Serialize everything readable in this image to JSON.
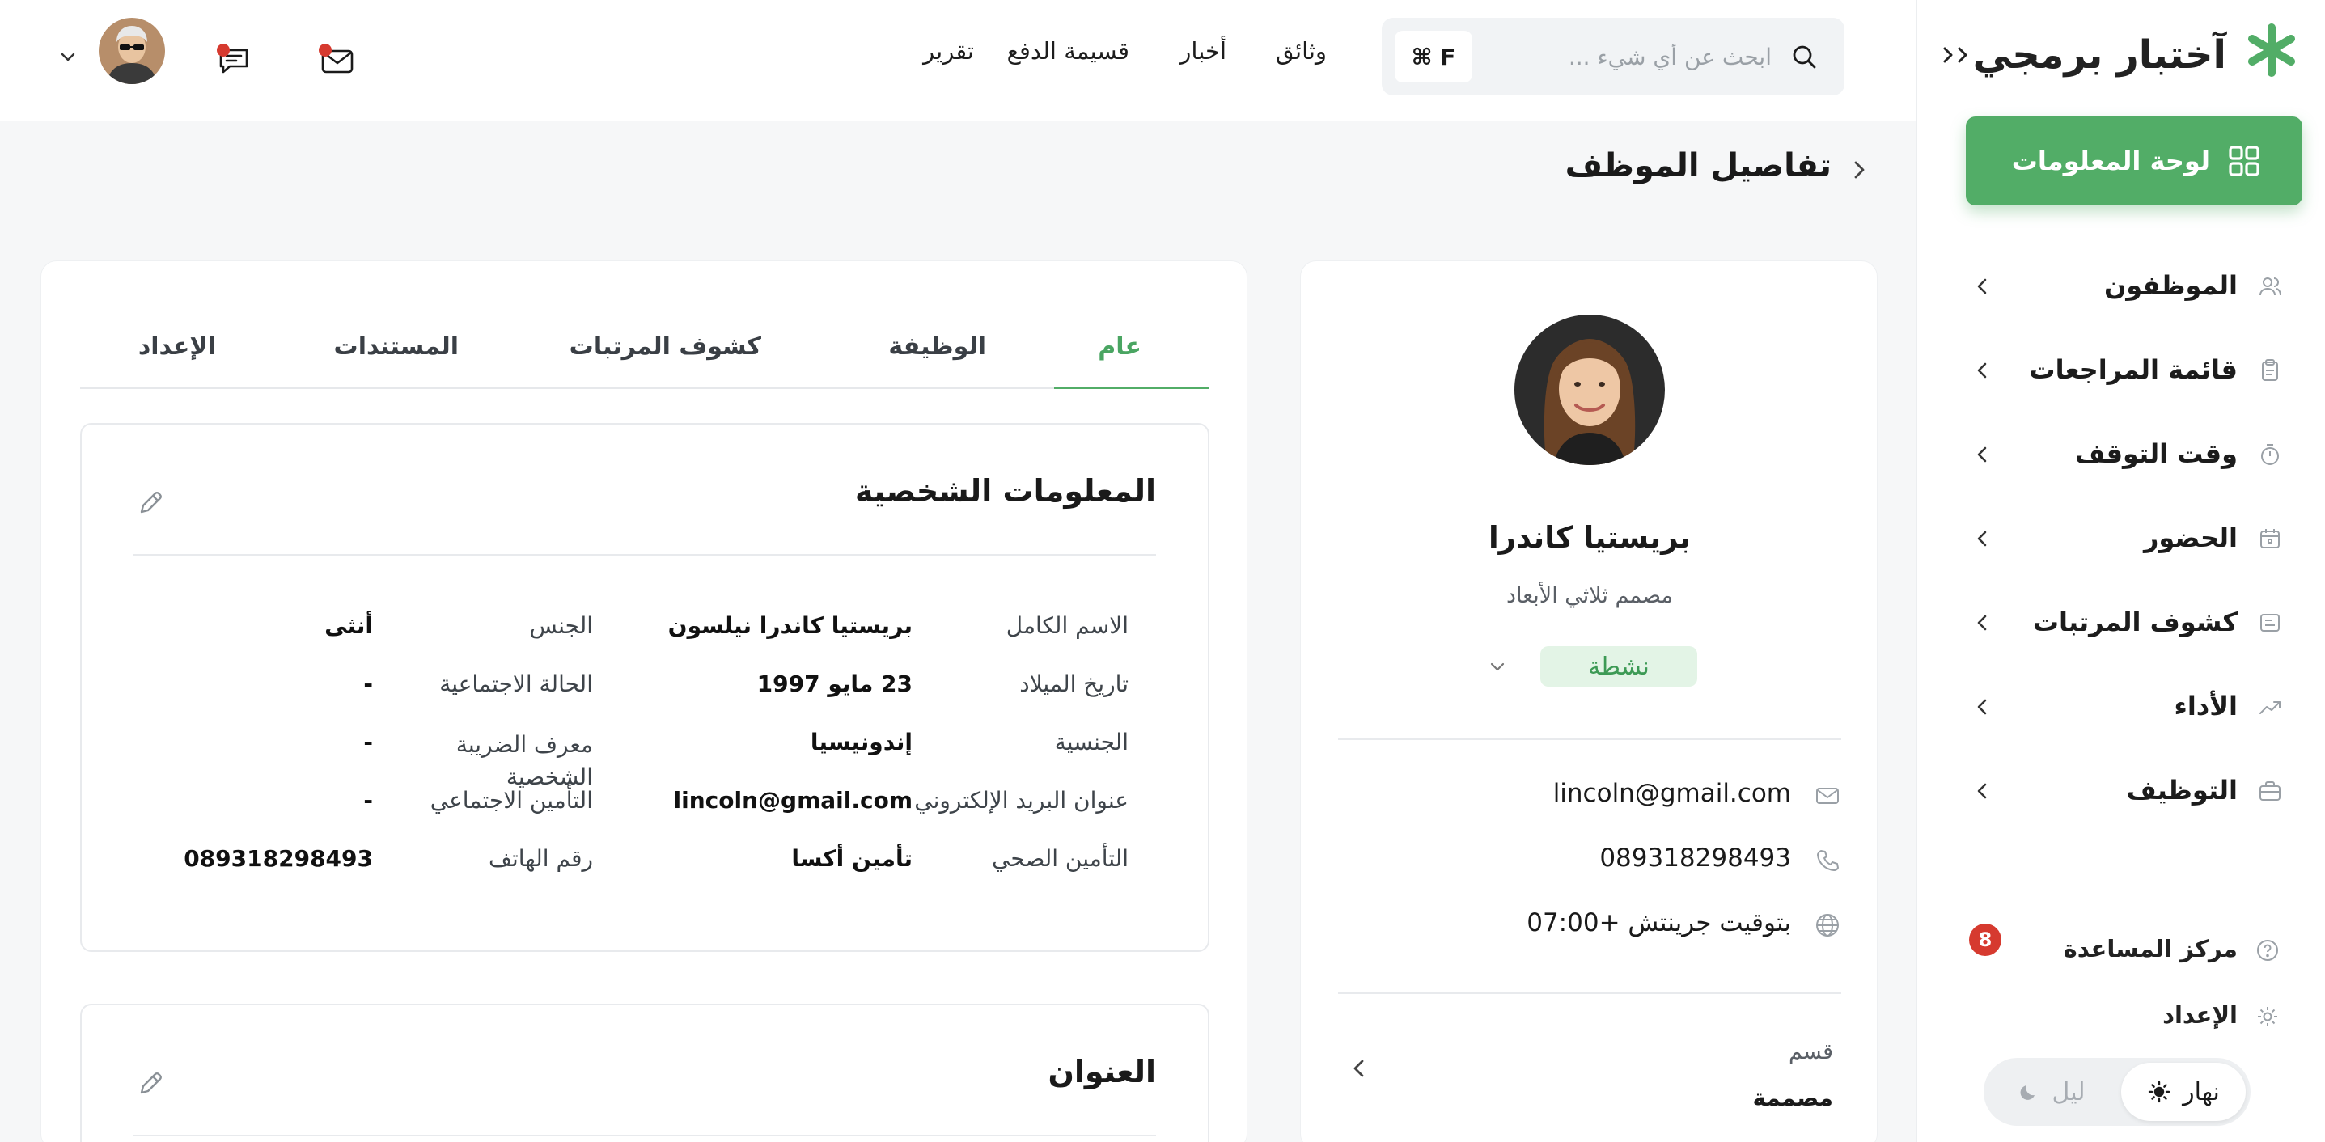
{
  "brand": {
    "name": "آختبار برمجي"
  },
  "sidebar": {
    "dashboard_label": "لوحة المعلومات",
    "items": [
      {
        "label": "الموظفون"
      },
      {
        "label": "قائمة المراجعات"
      },
      {
        "label": "وقت التوقف"
      },
      {
        "label": "الحضور"
      },
      {
        "label": "كشوف المرتبات"
      },
      {
        "label": "الأداء"
      },
      {
        "label": "التوظيف"
      }
    ],
    "help": {
      "label": "مركز المساعدة",
      "badge": "8"
    },
    "setup": {
      "label": "الإعداد"
    },
    "theme": {
      "day": "نهار",
      "night": "ليل"
    }
  },
  "topbar": {
    "search_placeholder": "ابحث عن أي شيء ...",
    "shortcut": "⌘ F",
    "links": [
      "وثائق",
      "أخبار",
      "قسيمة الدفع",
      "تقرير"
    ]
  },
  "page": {
    "title": "تفاصيل الموظف"
  },
  "profile": {
    "name": "بريستيا كاندرا",
    "role": "مصمم ثلاثي الأبعاد",
    "status": "نشطة",
    "email": "lincoln@gmail.com",
    "phone": "089318298493",
    "timezone": "بتوقيت جرينتش +07:00",
    "department_label": "قسم",
    "department_value": "مصممة"
  },
  "tabs": [
    "عام",
    "الوظيفة",
    "كشوف المرتبات",
    "المستندات",
    "الإعداد"
  ],
  "personal": {
    "title": "المعلومات الشخصية",
    "fields_right": [
      {
        "label": "الاسم الكامل",
        "value": "بريستيا كاندرا نيلسون"
      },
      {
        "label": "تاريخ الميلاد",
        "value": "23 مايو 1997"
      },
      {
        "label": "الجنسية",
        "value": "إندونيسيا"
      },
      {
        "label": "عنوان البريد الإلكتروني",
        "value": "lincoln@gmail.com"
      },
      {
        "label": "التأمين الصحي",
        "value": "تأمين أكسا"
      }
    ],
    "fields_left": [
      {
        "label": "الجنس",
        "value": "أنثى"
      },
      {
        "label": "الحالة الاجتماعية",
        "value": "-"
      },
      {
        "label": "معرف الضريبة الشخصية",
        "value": "-"
      },
      {
        "label": "التأمين الاجتماعي",
        "value": "-"
      },
      {
        "label": "رقم الهاتف",
        "value": "089318298493"
      }
    ]
  },
  "address": {
    "title": "العنوان"
  },
  "colors": {
    "accent": "#52ad67",
    "badge": "#d63a2f",
    "status_bg": "#e3f4e6"
  }
}
